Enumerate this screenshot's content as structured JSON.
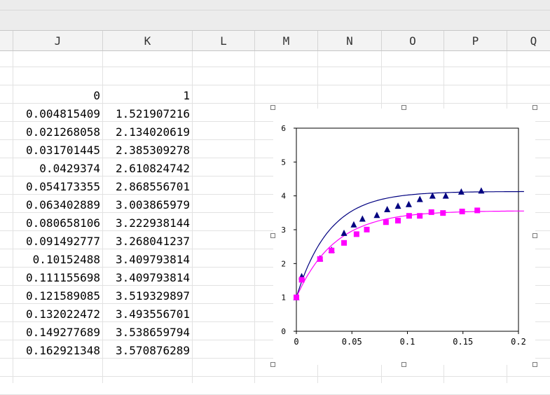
{
  "sheet": {
    "columns": [
      {
        "id": "col-header-blank",
        "label": ""
      },
      {
        "id": "col-header-j",
        "label": "J"
      },
      {
        "id": "col-header-k",
        "label": "K"
      },
      {
        "id": "col-header-l",
        "label": "L"
      },
      {
        "id": "col-header-m",
        "label": "M"
      },
      {
        "id": "col-header-n",
        "label": "N"
      },
      {
        "id": "col-header-o",
        "label": "O"
      },
      {
        "id": "col-header-p",
        "label": "P"
      },
      {
        "id": "col-header-q",
        "label": "Q"
      }
    ],
    "rows": [
      [
        "0",
        "1"
      ],
      [
        "0.004815409",
        "1.521907216"
      ],
      [
        "0.021268058",
        "2.134020619"
      ],
      [
        "0.031701445",
        "2.385309278"
      ],
      [
        "0.0429374",
        "2.610824742"
      ],
      [
        "0.054173355",
        "2.868556701"
      ],
      [
        "0.063402889",
        "3.003865979"
      ],
      [
        "0.080658106",
        "3.222938144"
      ],
      [
        "0.091492777",
        "3.268041237"
      ],
      [
        "0.10152488",
        "3.409793814"
      ],
      [
        "0.111155698",
        "3.409793814"
      ],
      [
        "0.121589085",
        "3.519329897"
      ],
      [
        "0.132022472",
        "3.493556701"
      ],
      [
        "0.149277689",
        "3.538659794"
      ],
      [
        "0.162921348",
        "3.570876289"
      ]
    ]
  },
  "chart_data": {
    "type": "scatter",
    "xlim": [
      0,
      0.2
    ],
    "ylim": [
      0,
      6
    ],
    "x_ticks": [
      "0",
      "0.05",
      "0.1",
      "0.15",
      "0.2"
    ],
    "y_ticks": [
      "0",
      "1",
      "2",
      "3",
      "4",
      "5",
      "6"
    ],
    "grid": false,
    "legend": "none",
    "series": [
      {
        "marker": "triangle",
        "color": "#000080",
        "points": [
          [
            0,
            1
          ],
          [
            0.0048,
            1.62
          ],
          [
            0.0213,
            2.15
          ],
          [
            0.0317,
            2.4
          ],
          [
            0.0429,
            2.9
          ],
          [
            0.0517,
            3.15
          ],
          [
            0.0595,
            3.32
          ],
          [
            0.0725,
            3.43
          ],
          [
            0.0818,
            3.6
          ],
          [
            0.0915,
            3.7
          ],
          [
            0.1012,
            3.75
          ],
          [
            0.1112,
            3.9
          ],
          [
            0.1226,
            4.0
          ],
          [
            0.1345,
            4.0
          ],
          [
            0.1485,
            4.12
          ],
          [
            0.1665,
            4.15
          ]
        ]
      },
      {
        "marker": "square",
        "color": "#ff00ff",
        "points": [
          [
            0,
            1
          ],
          [
            0.004815409,
            1.521907216
          ],
          [
            0.021268058,
            2.134020619
          ],
          [
            0.031701445,
            2.385309278
          ],
          [
            0.0429374,
            2.610824742
          ],
          [
            0.054173355,
            2.868556701
          ],
          [
            0.063402889,
            3.003865979
          ],
          [
            0.080658106,
            3.222938144
          ],
          [
            0.091492777,
            3.268041237
          ],
          [
            0.10152488,
            3.409793814
          ],
          [
            0.111155698,
            3.409793814
          ],
          [
            0.121589085,
            3.519329897
          ],
          [
            0.132022472,
            3.493556701
          ],
          [
            0.149277689,
            3.538659794
          ],
          [
            0.162921348,
            3.570876289
          ]
        ]
      }
    ],
    "fit_curves": [
      {
        "color": "#000080",
        "plateau": 4.13,
        "start": 1,
        "rate": 33.8,
        "x_max": 0.205
      },
      {
        "color": "#ff00ff",
        "plateau": 3.56,
        "start": 1,
        "rate": 29.0,
        "x_max": 0.205
      }
    ]
  }
}
